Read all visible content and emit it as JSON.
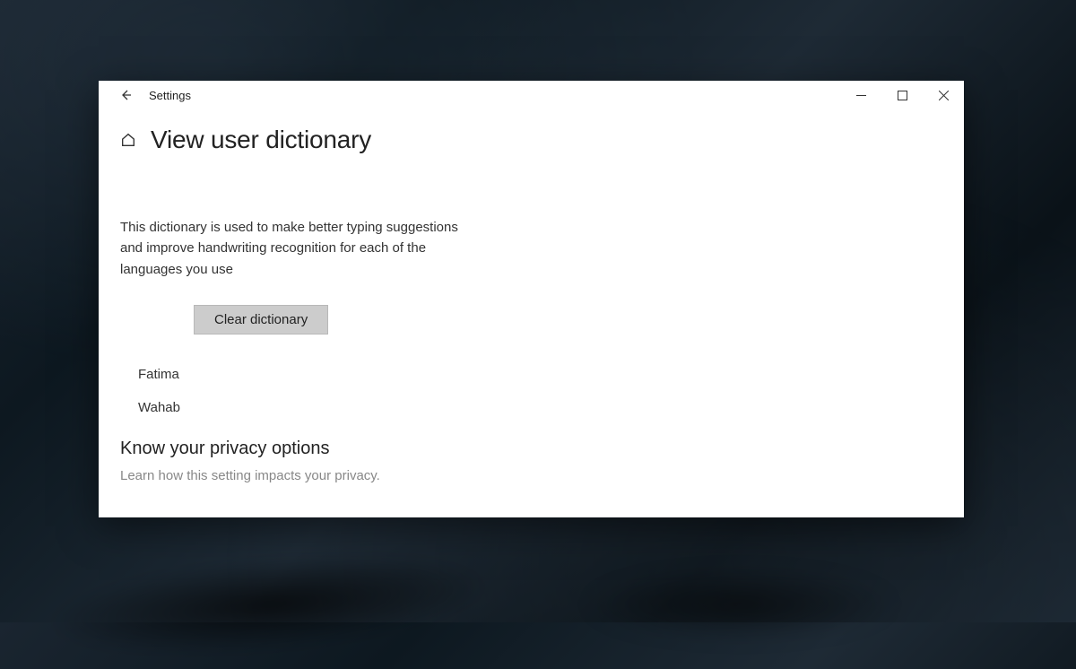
{
  "titlebar": {
    "app_name": "Settings"
  },
  "header": {
    "page_title": "View user dictionary"
  },
  "main": {
    "description": "This dictionary is used to make better typing suggestions and improve handwriting recognition for each of the languages you use",
    "clear_button_label": "Clear dictionary",
    "words": [
      "Fatima",
      "Wahab"
    ]
  },
  "privacy": {
    "heading": "Know your privacy options",
    "subtitle": "Learn how this setting impacts your privacy."
  }
}
